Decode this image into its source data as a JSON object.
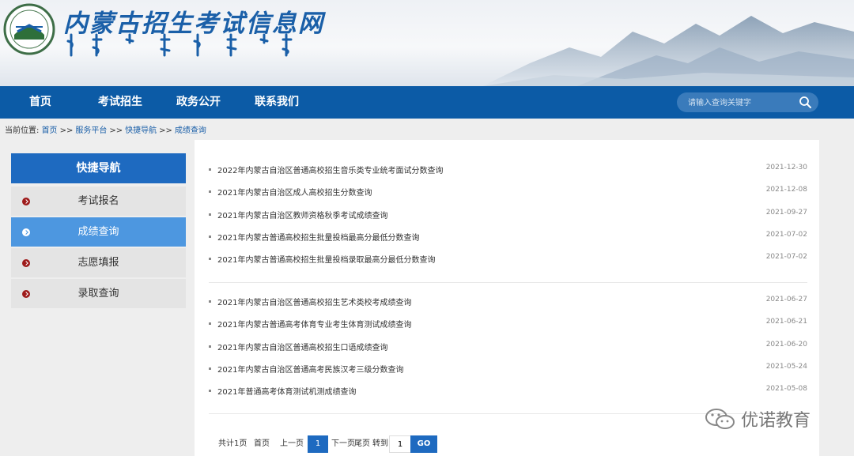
{
  "header": {
    "site_title": "内蒙古招生考试信息网",
    "mongolian_title": "ᠥᠪᠦᠷ ᠮᠣᠩᠭᠣᠯ"
  },
  "nav": {
    "items": [
      "首页",
      "考试招生",
      "政务公开",
      "联系我们"
    ],
    "search_placeholder": "请输入查询关键字"
  },
  "breadcrumb": {
    "prefix": "当前位置:",
    "items": [
      "首页",
      "服务平台",
      "快捷导航",
      "成绩查询"
    ],
    "separator": ">>"
  },
  "sidebar": {
    "title": "快捷导航",
    "items": [
      {
        "label": "考试报名",
        "active": false
      },
      {
        "label": "成绩查询",
        "active": true
      },
      {
        "label": "志愿填报",
        "active": false
      },
      {
        "label": "录取查询",
        "active": false
      }
    ]
  },
  "list": {
    "group1": [
      {
        "title": "2022年内蒙古自治区普通高校招生音乐类专业统考面试分数查询",
        "date": "2021-12-30"
      },
      {
        "title": "2021年内蒙古自治区成人高校招生分数查询",
        "date": "2021-12-08"
      },
      {
        "title": "2021年内蒙古自治区教师资格秋季考试成绩查询",
        "date": "2021-09-27"
      },
      {
        "title": "2021年内蒙古普通高校招生批量投档最高分最低分数查询",
        "date": "2021-07-02"
      },
      {
        "title": "2021年内蒙古普通高校招生批量投档录取最高分最低分数查询",
        "date": "2021-07-02"
      }
    ],
    "group2": [
      {
        "title": "2021年内蒙古自治区普通高校招生艺术类校考成绩查询",
        "date": "2021-06-27"
      },
      {
        "title": "2021年内蒙古普通高考体育专业考生体育测试成绩查询",
        "date": "2021-06-21"
      },
      {
        "title": "2021年内蒙古自治区普通高校招生口语成绩查询",
        "date": "2021-06-20"
      },
      {
        "title": "2021年内蒙古自治区普通高考民族汉考三级分数查询",
        "date": "2021-05-24"
      },
      {
        "title": "2021年普通高考体育测试机测成绩查询",
        "date": "2021-05-08"
      }
    ]
  },
  "pager": {
    "total": "共计1页",
    "first": "首页",
    "prev": "上一页",
    "current": "1",
    "next": "下一页",
    "last": "尾页",
    "goto": "转到",
    "goto_value": "1",
    "go": "GO"
  },
  "watermark": {
    "text": "优诺教育"
  },
  "colors": {
    "nav_blue": "#0c5ba6",
    "sidebar_head": "#1e6ac0",
    "sidebar_active": "#4d97e0",
    "bullet_red": "#9e1b1b"
  }
}
